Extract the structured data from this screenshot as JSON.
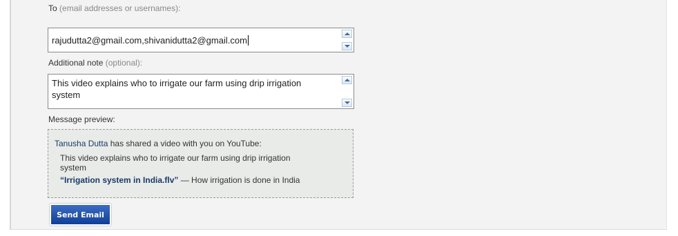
{
  "form": {
    "to_label": "To",
    "to_hint": "(email addresses or usernames):",
    "to_value": "rajudutta2@gmail.com,shivanidutta2@gmail.com",
    "note_label": "Additional note",
    "note_hint": "(optional):",
    "note_value": "This video explains who to irrigate our farm using drip irrigation\nsystem",
    "preview_label": "Message preview:",
    "send_button_label": "Send Email"
  },
  "preview": {
    "sender": "Tanusha Dutta",
    "shared_text": "has shared a video with you on YouTube:",
    "note_line1": "This video explains who to irrigate our farm using drip irrigation",
    "note_line2": "system",
    "video_title": "“Irrigation system in India.flv”",
    "separator": " — ",
    "video_description": "How irrigation is done in India"
  },
  "colors": {
    "panel_background": "#f3f3f3",
    "preview_background": "#e8ebe8",
    "link_color": "#1a3a66",
    "button_top": "#3d6cc4",
    "button_bottom": "#0f3f97"
  },
  "icons": {
    "scroll_up": "scroll-up-arrow-icon",
    "scroll_down": "scroll-down-arrow-icon"
  }
}
